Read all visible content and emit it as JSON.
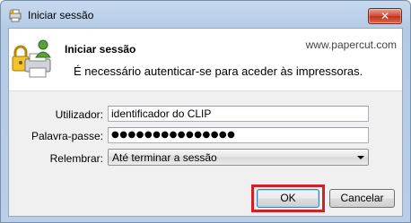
{
  "window": {
    "title": "Iniciar sessão",
    "close_label": "✕"
  },
  "header": {
    "title": "Iniciar sessão",
    "url": "www.papercut.com",
    "message": "É necessário autenticar-se para aceder às impressoras."
  },
  "form": {
    "username_label": "Utilizador:",
    "username_value": "identificador do CLIP",
    "password_label": "Palavra-passe:",
    "password_value": "●●●●●●●●●●●●●●●",
    "remember_label": "Relembrar:",
    "remember_value": "Até terminar a sessão"
  },
  "buttons": {
    "ok": "OK",
    "cancel": "Cancelar"
  },
  "icons": {
    "title_icon": "printer-key-icon",
    "header_icon": "printer-lock-user-icon"
  },
  "colors": {
    "highlight": "#d0202a",
    "close": "#c0321a"
  }
}
